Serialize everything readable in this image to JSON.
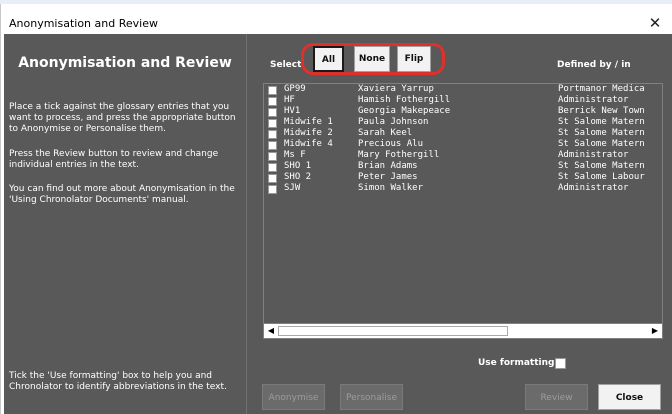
{
  "window": {
    "title": "Anonymisation and Review",
    "close_glyph": "✕"
  },
  "side": {
    "heading": "Anonymisation and Review",
    "para1": "Place a tick against the glossary entries that you want to process, and press the appropriate button to Anonymise or Personalise them.",
    "para2": "Press the Review button to review and change individual entries in the text.",
    "para3": "You can find out more about Anonymisation in the 'Using Chronolator Documents' manual.",
    "para4": "Tick the 'Use formatting' box to help you and Chronolator to identify abbreviations in the text."
  },
  "select": {
    "label": "Select",
    "all_label": "All",
    "none_label": "None",
    "flip_label": "Flip",
    "highlight_color": "#e0302c"
  },
  "list": {
    "defined_by_header": "Defined by / in",
    "rows": [
      {
        "abbr": "GP99",
        "name": "Xaviera Yarrup",
        "defined": "Portmanor Medica"
      },
      {
        "abbr": "HF",
        "name": "Hamish Fothergill",
        "defined": "Administrator"
      },
      {
        "abbr": "HV1",
        "name": "Georgia Makepeace",
        "defined": "Berrick New Town"
      },
      {
        "abbr": "Midwife 1",
        "name": "Paula Johnson",
        "defined": "St Salome Matern"
      },
      {
        "abbr": "Midwife 2",
        "name": "Sarah Keel",
        "defined": "St Salome Matern"
      },
      {
        "abbr": "Midwife 4",
        "name": "Precious Alu",
        "defined": "St Salome Matern"
      },
      {
        "abbr": "Ms F",
        "name": "Mary Fothergill",
        "defined": "Administrator"
      },
      {
        "abbr": "SHO 1",
        "name": "Brian Adams",
        "defined": "St Salome Matern"
      },
      {
        "abbr": "SHO 2",
        "name": "Peter James",
        "defined": "St Salome Labour"
      },
      {
        "abbr": "SJW",
        "name": "Simon Walker",
        "defined": "Administrator"
      }
    ]
  },
  "scrollbar": {
    "left_arrow": "◀",
    "right_arrow": "▶"
  },
  "formatting": {
    "label": "Use formatting"
  },
  "buttons": {
    "anonymise": "Anonymise",
    "personalise": "Personalise",
    "review": "Review",
    "close": "Close"
  }
}
